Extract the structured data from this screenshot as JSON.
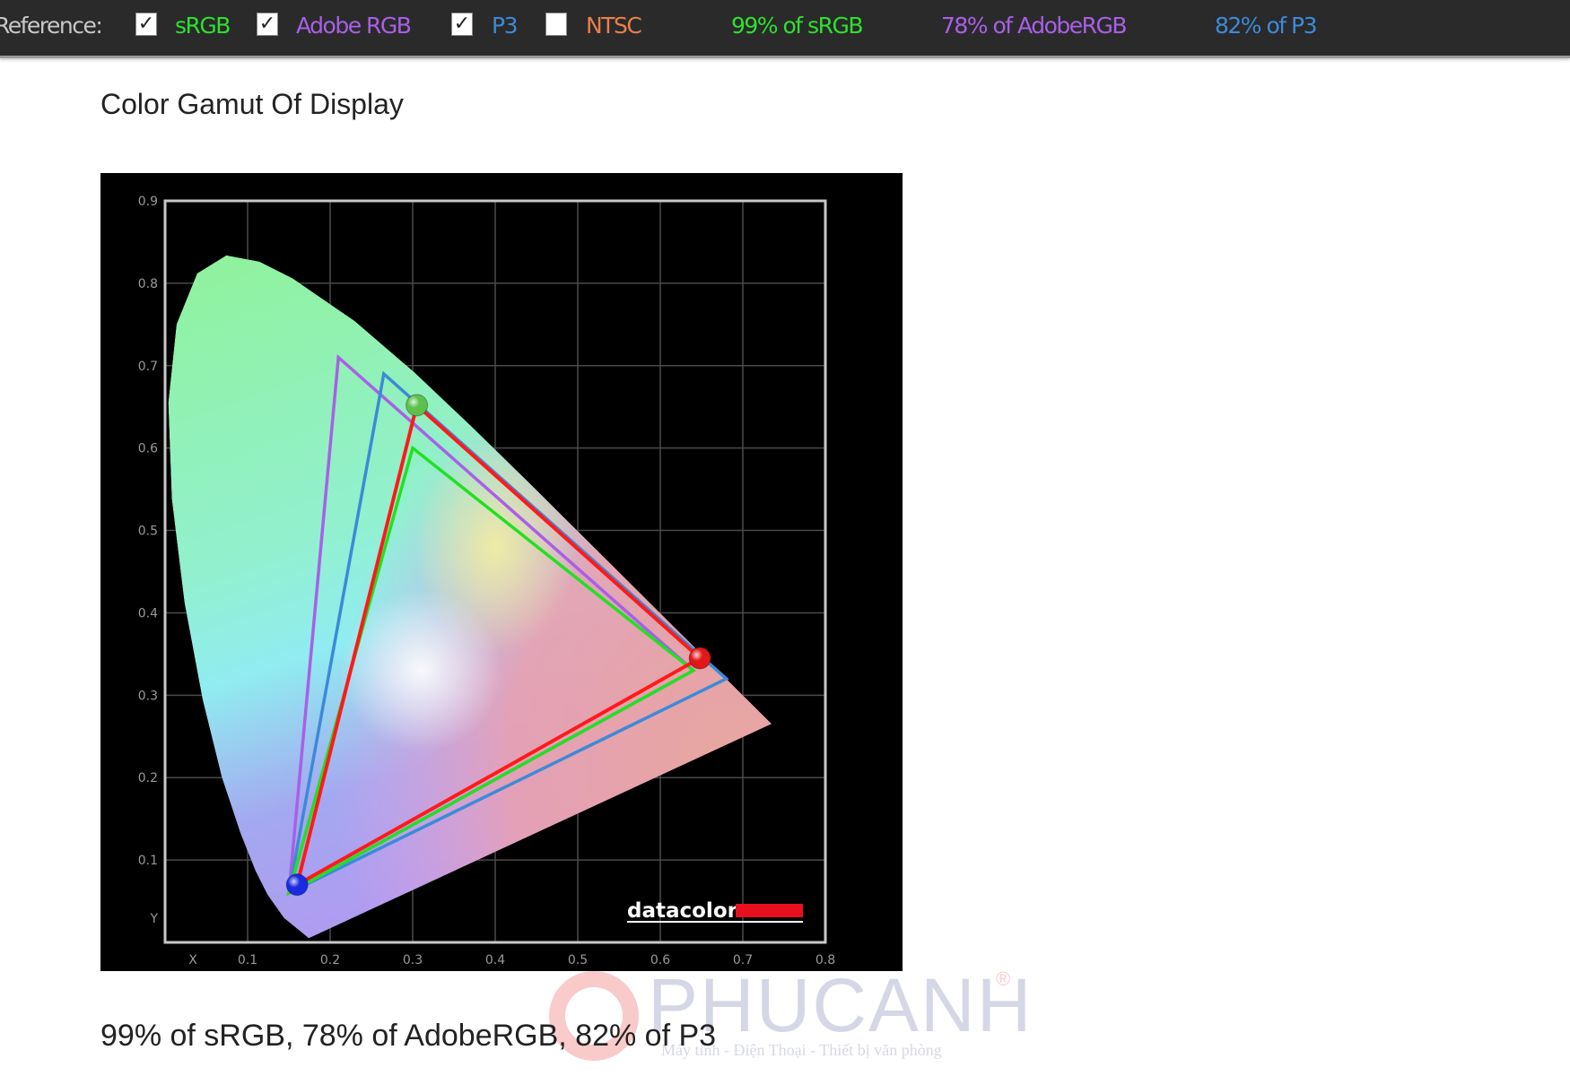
{
  "topbar": {
    "reference_label": "Reference:",
    "references": [
      {
        "label": "sRGB",
        "checked": true,
        "color": "#2ee02e"
      },
      {
        "label": "Adobe RGB",
        "checked": true,
        "color": "#a860e6"
      },
      {
        "label": "P3",
        "checked": true,
        "color": "#3c8ad8"
      },
      {
        "label": "NTSC",
        "checked": false,
        "color": "#e8804a"
      }
    ],
    "coverage": [
      {
        "text": "99% of sRGB",
        "color": "#2ee02e"
      },
      {
        "text": "78% of AdobeRGB",
        "color": "#a860e6"
      },
      {
        "text": "82% of P3",
        "color": "#3c8ad8"
      }
    ]
  },
  "section_title": "Color Gamut Of Display",
  "caption": "99% of sRGB, 78% of AdobeRGB, 82% of P3",
  "watermark": {
    "name": "PHUCANH",
    "tagline": "Máy tính - Điện Thoại - Thiết bị văn phòng",
    "reg": "®"
  },
  "chart_data": {
    "type": "scatter",
    "title": "",
    "xlabel": "X",
    "ylabel": "Y",
    "xlim": [
      0,
      0.8
    ],
    "ylim": [
      0,
      0.9
    ],
    "xticks": [
      "0.1",
      "0.2",
      "0.3",
      "0.4",
      "0.5",
      "0.6",
      "0.7",
      "0.8"
    ],
    "yticks": [
      "0.1",
      "0.2",
      "0.3",
      "0.4",
      "0.5",
      "0.6",
      "0.7",
      "0.8",
      "0.9"
    ],
    "grid": true,
    "logo": "datacolor",
    "spectral_locus": [
      [
        0.1741,
        0.005
      ],
      [
        0.144,
        0.0297
      ],
      [
        0.1241,
        0.0578
      ],
      [
        0.1096,
        0.0868
      ],
      [
        0.0913,
        0.1327
      ],
      [
        0.0687,
        0.2007
      ],
      [
        0.0454,
        0.295
      ],
      [
        0.0235,
        0.4127
      ],
      [
        0.0082,
        0.5384
      ],
      [
        0.0039,
        0.6548
      ],
      [
        0.0139,
        0.7502
      ],
      [
        0.0389,
        0.812
      ],
      [
        0.0743,
        0.8338
      ],
      [
        0.1142,
        0.8262
      ],
      [
        0.1547,
        0.8059
      ],
      [
        0.2296,
        0.7543
      ],
      [
        0.3016,
        0.6923
      ],
      [
        0.3731,
        0.6245
      ],
      [
        0.4441,
        0.5547
      ],
      [
        0.5125,
        0.4866
      ],
      [
        0.5752,
        0.4242
      ],
      [
        0.627,
        0.3725
      ],
      [
        0.6915,
        0.3083
      ],
      [
        0.7347,
        0.2653
      ]
    ],
    "series": [
      {
        "name": "Adobe RGB",
        "color": "#a860e6",
        "points": [
          [
            0.64,
            0.33
          ],
          [
            0.21,
            0.71
          ],
          [
            0.15,
            0.06
          ]
        ]
      },
      {
        "name": "P3",
        "color": "#3c8ad8",
        "points": [
          [
            0.68,
            0.32
          ],
          [
            0.265,
            0.69
          ],
          [
            0.15,
            0.06
          ]
        ]
      },
      {
        "name": "sRGB",
        "color": "#22e022",
        "points": [
          [
            0.64,
            0.33
          ],
          [
            0.3,
            0.6
          ],
          [
            0.15,
            0.06
          ]
        ]
      },
      {
        "color": "#ff1a1a",
        "points": [
          [
            0.648,
            0.345
          ],
          [
            0.305,
            0.652
          ],
          [
            0.16,
            0.07
          ]
        ]
      }
    ]
  }
}
